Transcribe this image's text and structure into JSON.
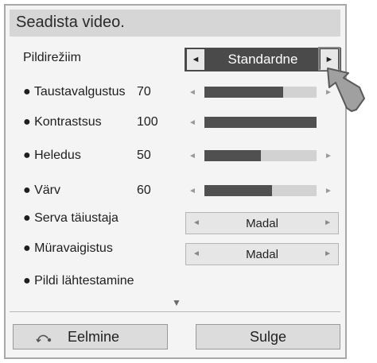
{
  "title": "Seadista video.",
  "rows": [
    {
      "label": "Pildirežiim",
      "value": ""
    },
    {
      "label": "● Taustavalgustus",
      "value": "70"
    },
    {
      "label": "● Kontrastsus",
      "value": "100"
    },
    {
      "label": "● Heledus",
      "value": "50"
    },
    {
      "label": "● Värv",
      "value": "60"
    },
    {
      "label": "● Serva täiustaja",
      "value": ""
    },
    {
      "label": "● Müravaigistus",
      "value": ""
    },
    {
      "label": "● Pildi lähtestamine",
      "value": ""
    }
  ],
  "picture_mode": {
    "value": "Standardne",
    "left_arrow": "◄",
    "right_arrow": "►"
  },
  "sliders": {
    "taustavalgustus": {
      "level": 0.7
    },
    "kontrastsus": {
      "level": 1.0
    },
    "heledus": {
      "level": 0.5
    },
    "varv": {
      "level": 0.6
    }
  },
  "slider_arrows": {
    "left": "◄",
    "right": "►"
  },
  "edge_enhancer": {
    "value": "Madal",
    "left": "◄",
    "right": "►"
  },
  "noise_reduction": {
    "value": "Madal",
    "left": "◄",
    "right": "►"
  },
  "scroll_indicator": "▼",
  "buttons": {
    "back": "Eelmine",
    "close": "Sulge"
  },
  "icons": {
    "back": "back-icon",
    "cursor": "pointer-hand-icon"
  },
  "colors": {
    "slider_fill": "#505050",
    "slider_track": "#d2d2d2",
    "selector_bg": "#4a4a4a",
    "title_bar": "#d6d6d6"
  }
}
